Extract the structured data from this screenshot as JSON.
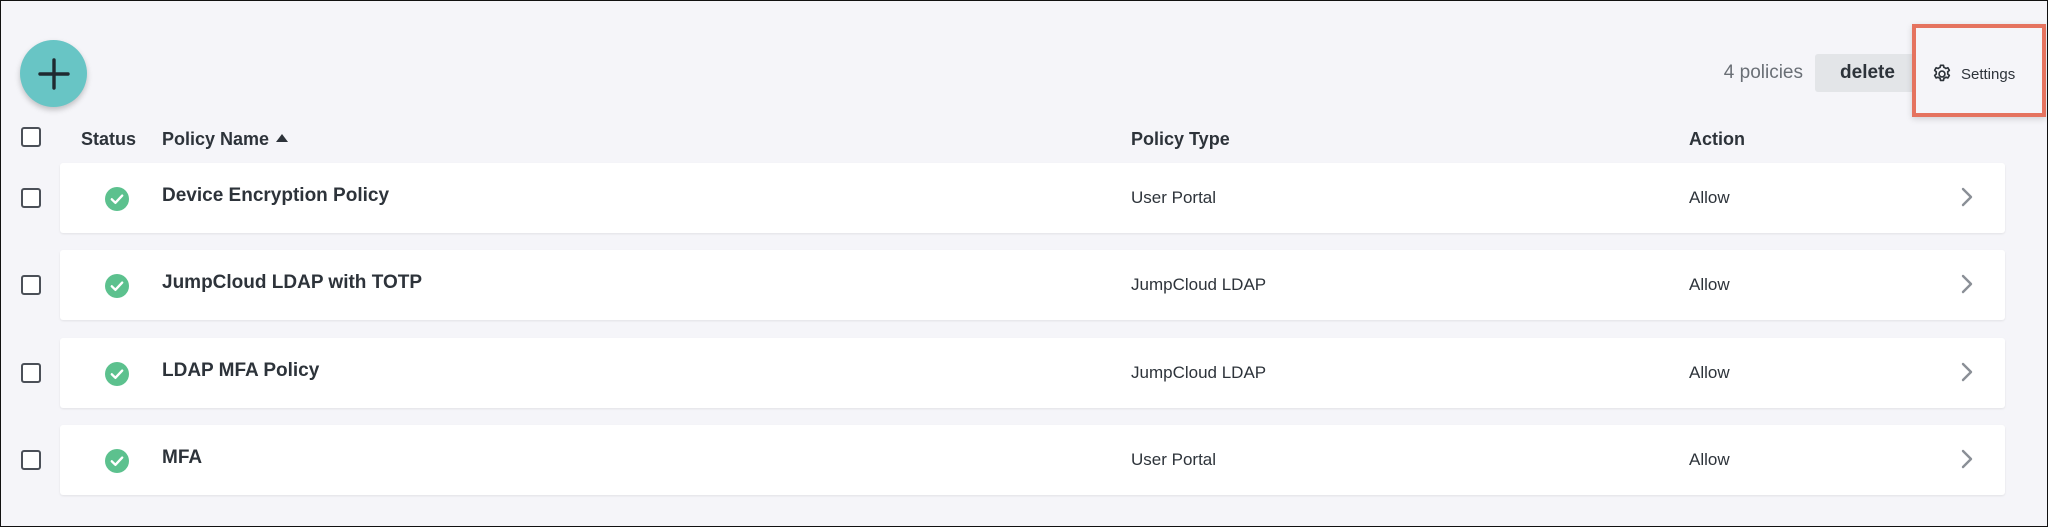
{
  "toolbar": {
    "add_icon": "plus-icon",
    "policy_count": "4 policies",
    "delete_label": "delete",
    "settings_label": "Settings",
    "settings_icon": "gear-icon"
  },
  "table": {
    "headers": {
      "status": "Status",
      "name": "Policy Name",
      "type": "Policy Type",
      "action": "Action"
    },
    "sort": {
      "column": "Policy Name",
      "direction": "ascending"
    },
    "rows": [
      {
        "name": "Device Encryption Policy",
        "type": "User Portal",
        "action": "Allow",
        "status": "active"
      },
      {
        "name": "JumpCloud LDAP with TOTP",
        "type": "JumpCloud LDAP",
        "action": "Allow",
        "status": "active"
      },
      {
        "name": "LDAP MFA Policy",
        "type": "JumpCloud LDAP",
        "action": "Allow",
        "status": "active"
      },
      {
        "name": "MFA",
        "type": "User Portal",
        "action": "Allow",
        "status": "active"
      }
    ]
  },
  "colors": {
    "accent_teal": "#68c5c5",
    "status_green": "#5cc18e",
    "highlight_red": "#e5735f",
    "background": "#f5f5f9"
  }
}
